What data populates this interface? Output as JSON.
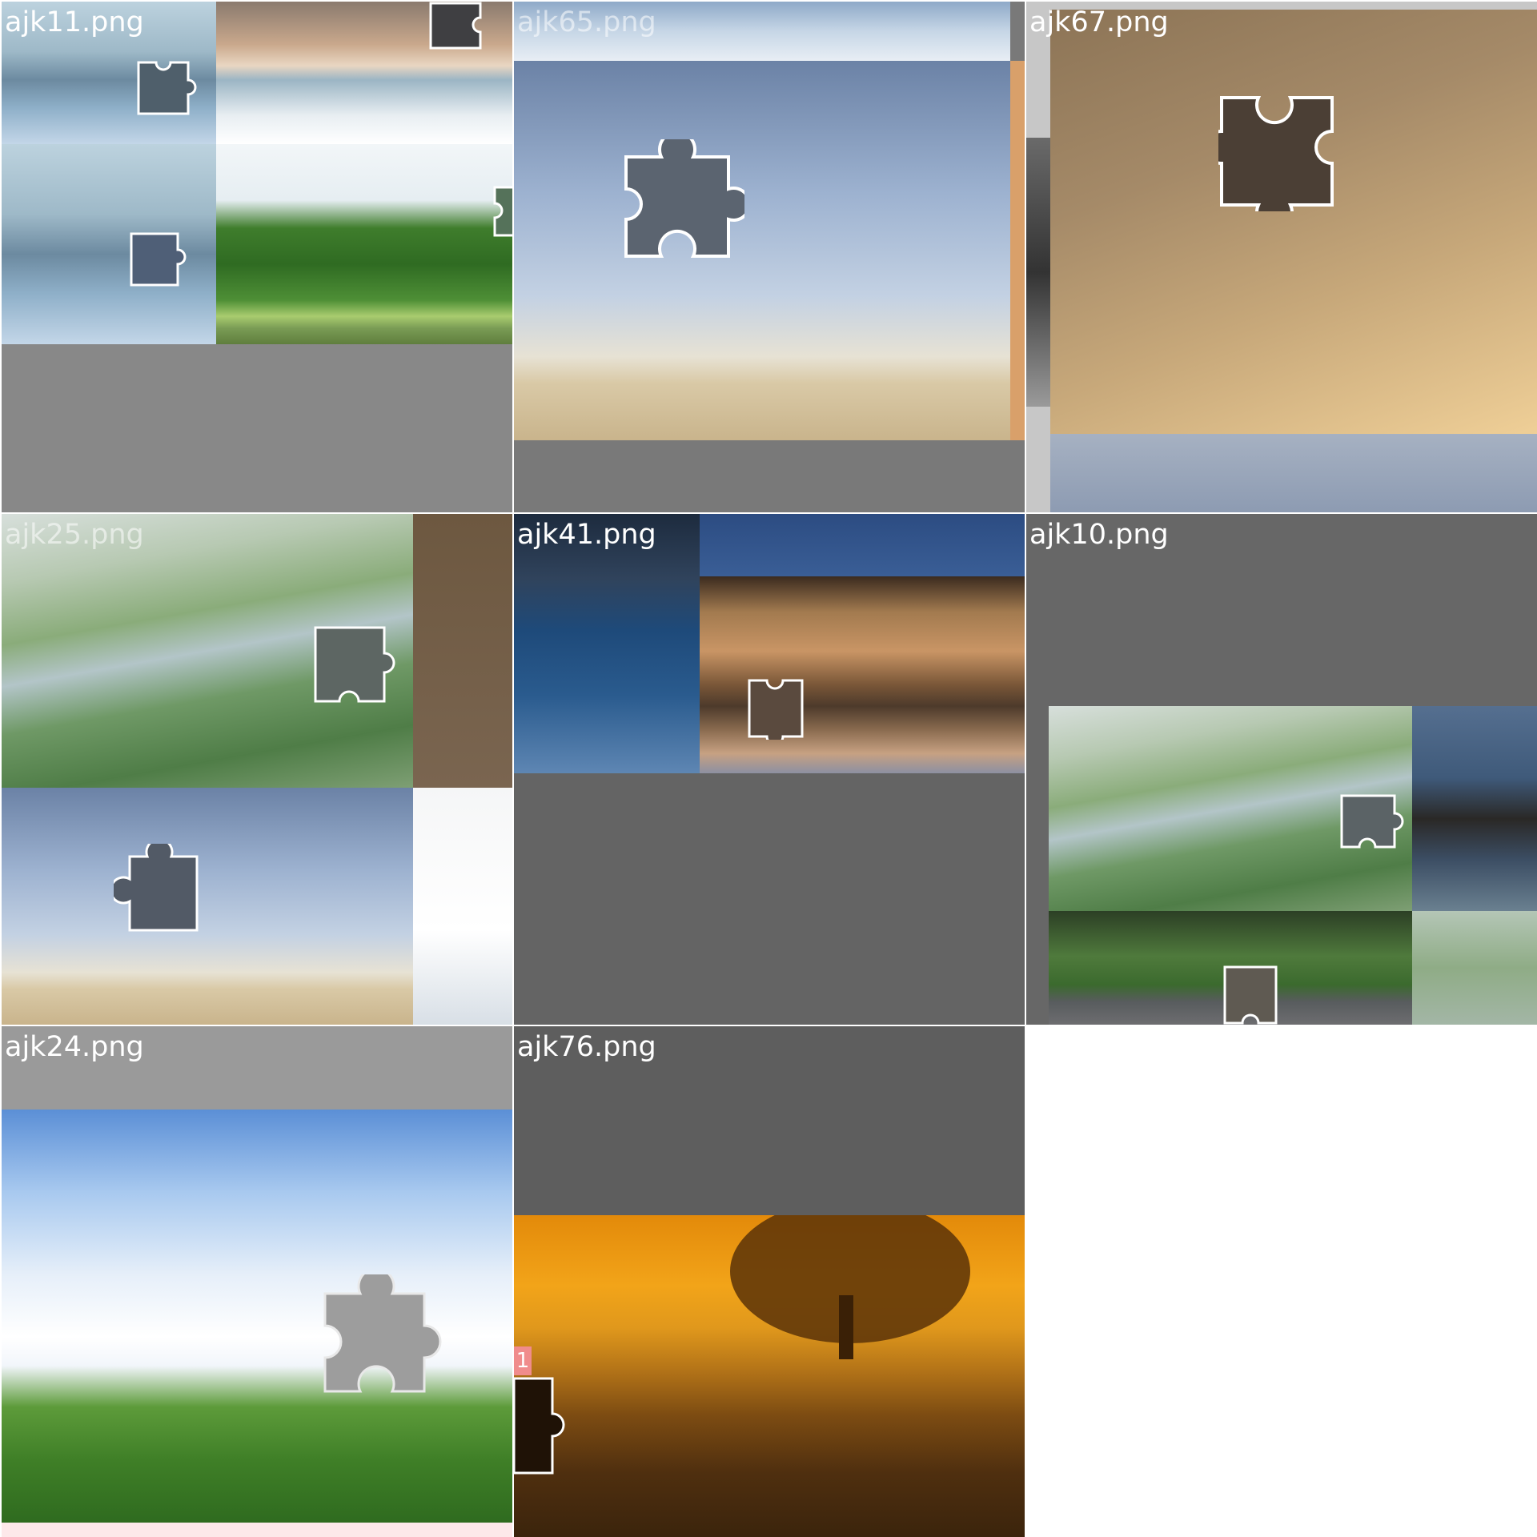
{
  "cells": [
    {
      "label": "ajk11.png"
    },
    {
      "label": "ajk65.png"
    },
    {
      "label": "ajk67.png"
    },
    {
      "label": "ajk25.png"
    },
    {
      "label": "ajk41.png"
    },
    {
      "label": "ajk10.png"
    },
    {
      "label": "ajk24.png"
    },
    {
      "label": "ajk76.png"
    }
  ],
  "marker": {
    "text": "1",
    "color": "#f08c8c"
  },
  "icons": [
    "puzzle-piece-icon"
  ]
}
